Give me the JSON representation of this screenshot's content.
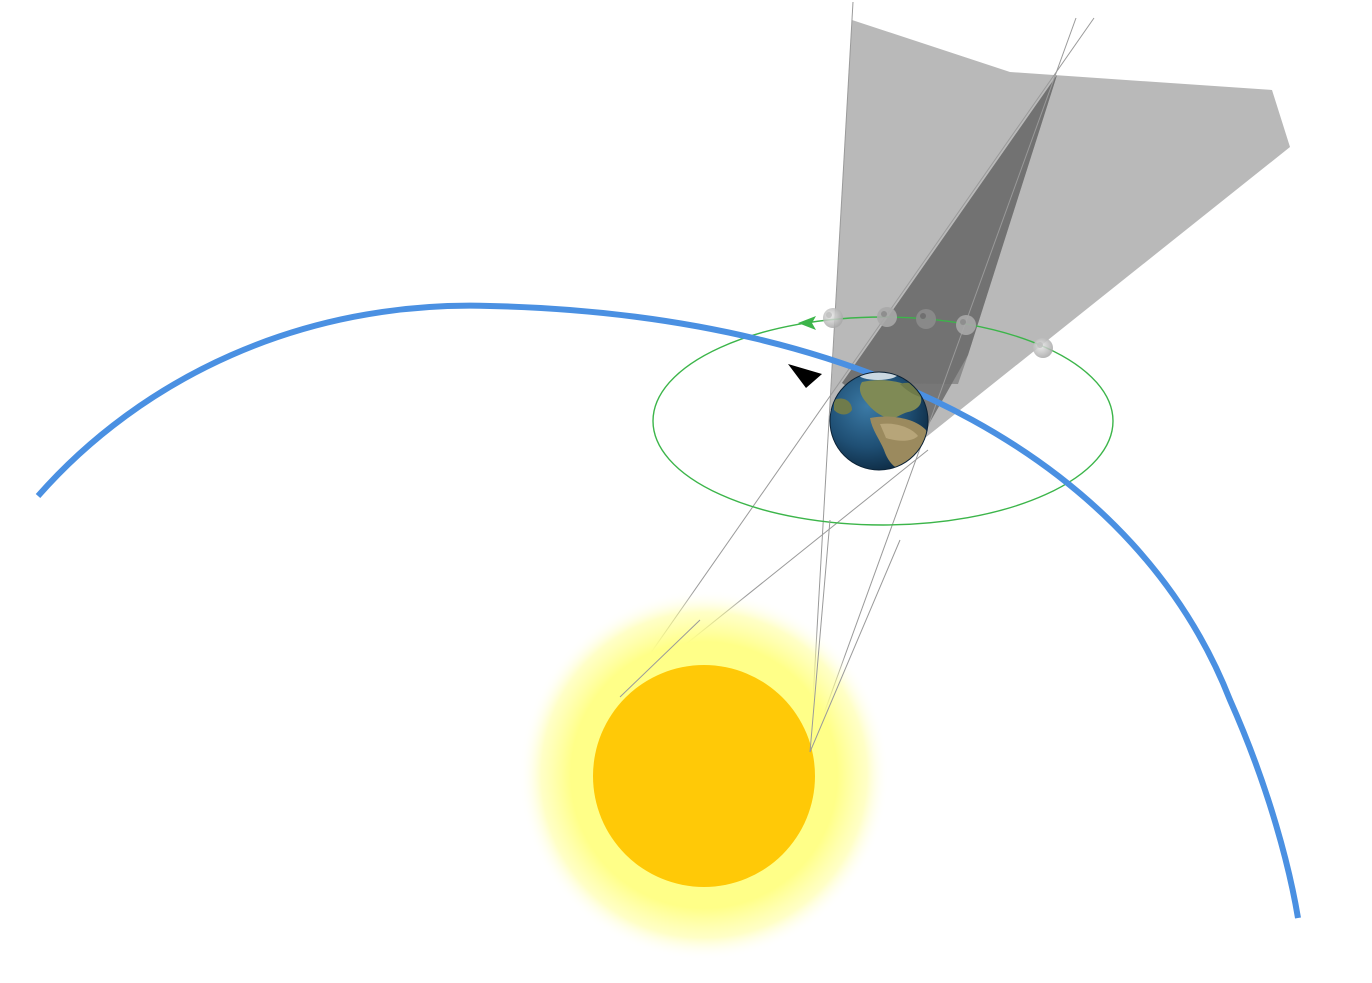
{
  "colors": {
    "background": "#ffffff",
    "earth_orbit": "#4a90e2",
    "moon_orbit": "#3cb54a",
    "moon_orbit_arrow": "#3cb54a",
    "direction_arrow": "#000000",
    "penumbra": "#b9b9b9",
    "umbra": "#777777",
    "sun_core": "#ffc907",
    "sun_glow": "#ffff88",
    "shadow_rays": "#9a9a9a",
    "earth_ocean": "#1f4f74",
    "earth_land": "#8a8a5c",
    "moon": "#c8c8c8"
  },
  "icons": {
    "sun": "sun-icon",
    "earth": "earth-globe-icon",
    "moon": "moon-icon",
    "direction": "arrowhead-icon"
  },
  "moon_positions_count": 5
}
